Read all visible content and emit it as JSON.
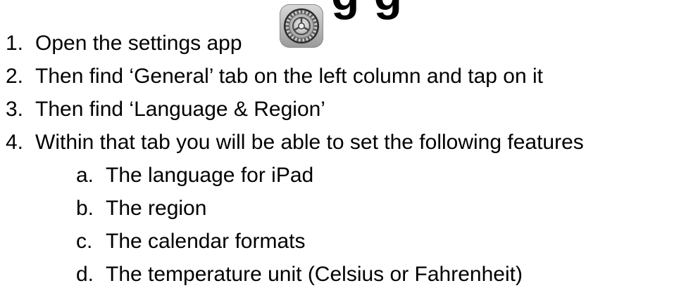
{
  "heading_fragment": "g g",
  "icon": "settings-gear-icon",
  "steps": [
    {
      "num": "1.",
      "text": "Open the settings app"
    },
    {
      "num": "2.",
      "text": "Then find ‘General’ tab on the left column and tap on it"
    },
    {
      "num": "3.",
      "text": "Then find ‘Language & Region’"
    },
    {
      "num": "4.",
      "text": "Within that tab you will be able to set the following features"
    }
  ],
  "substeps": [
    {
      "num": "a.",
      "text": "The language for iPad"
    },
    {
      "num": "b.",
      "text": "The region"
    },
    {
      "num": "c.",
      "text": "The calendar formats"
    },
    {
      "num": "d.",
      "text": "The temperature unit (Celsius or Fahrenheit)"
    }
  ]
}
